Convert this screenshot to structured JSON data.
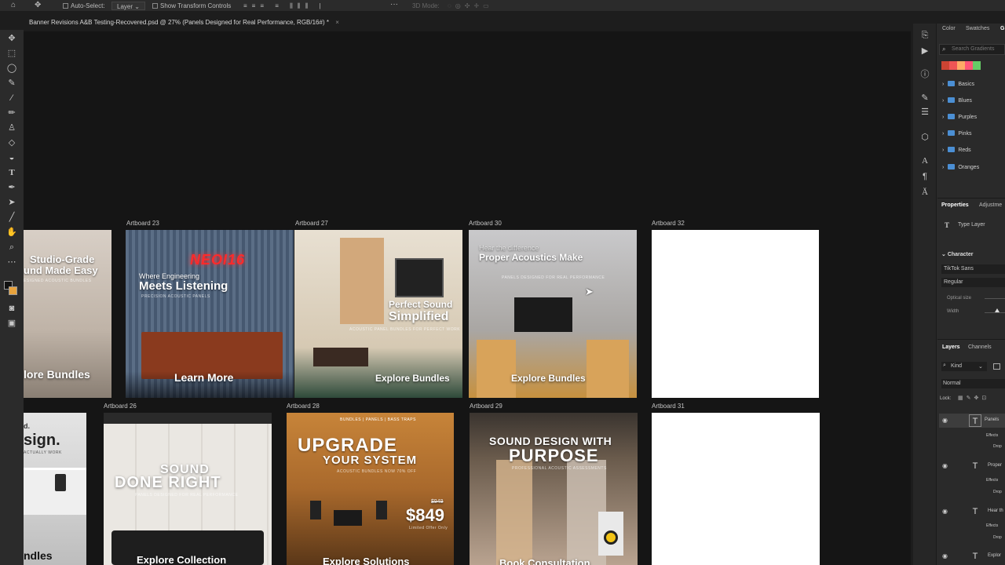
{
  "options_bar": {
    "auto_select_label": "Auto-Select:",
    "layer_select": "Layer",
    "show_transform_label": "Show Transform Controls",
    "mode_3d_label": "3D Mode:",
    "more": "···"
  },
  "document": {
    "tab_title": "Banner Revisions A&B Testing-Recovered.psd @ 27% (Panels Designed for Real Performance, RGB/16#) *",
    "close": "×"
  },
  "artboards": {
    "row1": [
      {
        "label": "",
        "headline": "Studio-Grade",
        "headline2": "und Made Easy",
        "sub": "ESIGNED ACOUSTIC BUNDLES",
        "cta": "lore Bundles"
      },
      {
        "label": "Artboard 23",
        "brand": "NEOI16",
        "small": "Where Engineering",
        "headline": "Meets Listening",
        "sub": "PRECISION ACOUSTIC PANELS",
        "cta": "Learn More"
      },
      {
        "label": "Artboard 27",
        "headline": "Perfect Sound",
        "headline2": "Simplified",
        "sub": "ACOUSTIC PANEL BUNDLES FOR PERFECT WORK",
        "cta": "Explore Bundles"
      },
      {
        "label": "Artboard 30",
        "small": "Hear the difference",
        "headline": "Proper Acoustics Make",
        "sub": "PANELS DESIGNED FOR REAL PERFORMANCE",
        "cta": "Explore Bundles"
      },
      {
        "label": "Artboard 32"
      }
    ],
    "row2": [
      {
        "label": "",
        "headline": "sign.",
        "small": "d.",
        "sub": "ACTUALLY WORK",
        "cta": "ndles"
      },
      {
        "label": "Artboard 26",
        "headline": "SOUND",
        "headline2": "DONE RIGHT",
        "sub": "PANELS DESIGNED FOR REAL PERFORMANCE",
        "cta": "Explore Collection"
      },
      {
        "label": "Artboard 28",
        "kicker": "BUNDLES | PANELS | BASS TRAPS",
        "headline": "UPGRADE",
        "headline2": "YOUR SYSTEM",
        "sub": "ACOUSTIC BUNDLES NOW 70% OFF",
        "old_price": "$949",
        "price": "$849",
        "offer": "Limited Offer Only",
        "cta": "Explore Solutions"
      },
      {
        "label": "Artboard 29",
        "headline": "SOUND DESIGN WITH",
        "headline2": "PURPOSE",
        "sub": "PROFESSIONAL ACOUSTIC ASSESSMENTS",
        "cta": "Book Consultation"
      },
      {
        "label": "Artboard 31"
      }
    ]
  },
  "right_panel": {
    "tabs": [
      "Color",
      "Swatches",
      "G"
    ],
    "search_placeholder": "Search Gradients",
    "gradient_folders": [
      "Basics",
      "Blues",
      "Purples",
      "Pinks",
      "Reds",
      "Oranges"
    ],
    "properties_tab": "Properties",
    "adjustments_tab": "Adjustme",
    "type_layer": "Type Layer",
    "character_title": "Character",
    "font_family": "TikTok Sans",
    "font_style": "Regular",
    "optical_size": "Optical size",
    "width": "Width",
    "layers_tab": "Layers",
    "channels_tab": "Channels",
    "kind_filter": "Kind",
    "blend_mode": "Normal",
    "lock_label": "Lock:",
    "layers": [
      {
        "name": "Panels",
        "fx": "Effects",
        "sub": "Drop"
      },
      {
        "name": "Proper",
        "fx": "Effects",
        "sub": "Drop"
      },
      {
        "name": "Hear th",
        "fx": "Effects",
        "sub": "Drop"
      },
      {
        "name": "Explor",
        "fx": "",
        "sub": ""
      }
    ]
  },
  "colors": {
    "accent_orange": "#e8a33d",
    "neon_red": "#ff2a2a",
    "folder_blue": "#4b8fd4"
  }
}
